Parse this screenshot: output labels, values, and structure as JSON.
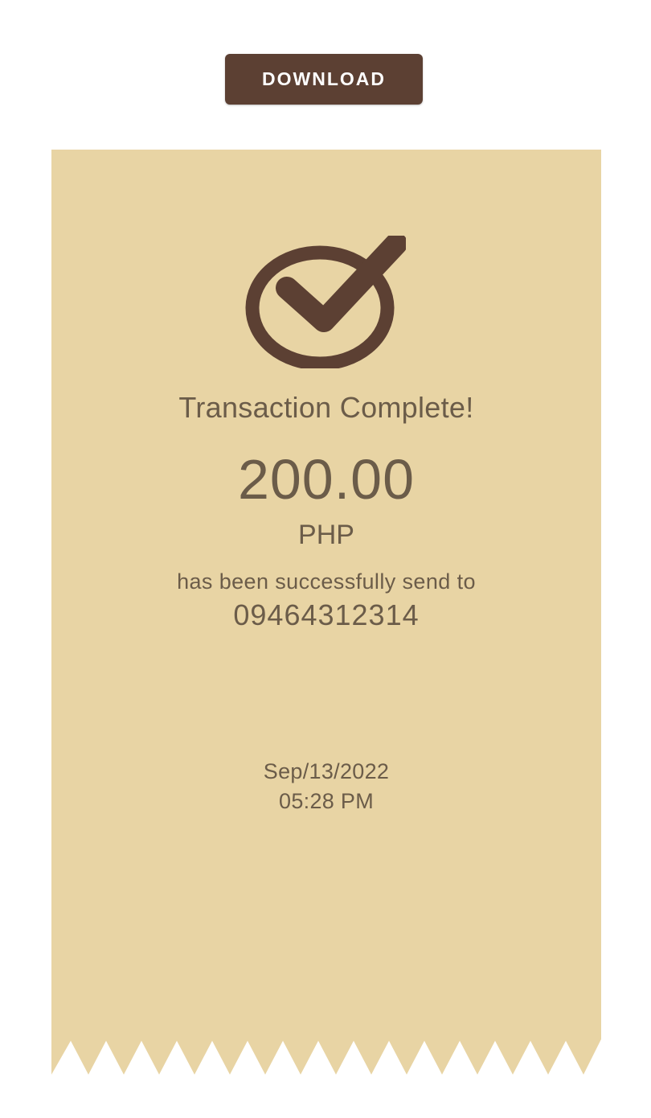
{
  "colors": {
    "button_bg": "#5c4033",
    "button_text": "#ffffff",
    "receipt_bg": "#e8d4a4",
    "icon": "#5c4033",
    "text": "#6b5c49",
    "page_bg": "#ffffff"
  },
  "header": {
    "download_label": "DOWNLOAD"
  },
  "receipt": {
    "icon": "check-circle-icon",
    "title": "Transaction Complete!",
    "amount": "200.00",
    "currency": "PHP",
    "message": "has been successfully send to",
    "recipient": "09464312314",
    "date": "Sep/13/2022",
    "time": "05:28 PM"
  }
}
